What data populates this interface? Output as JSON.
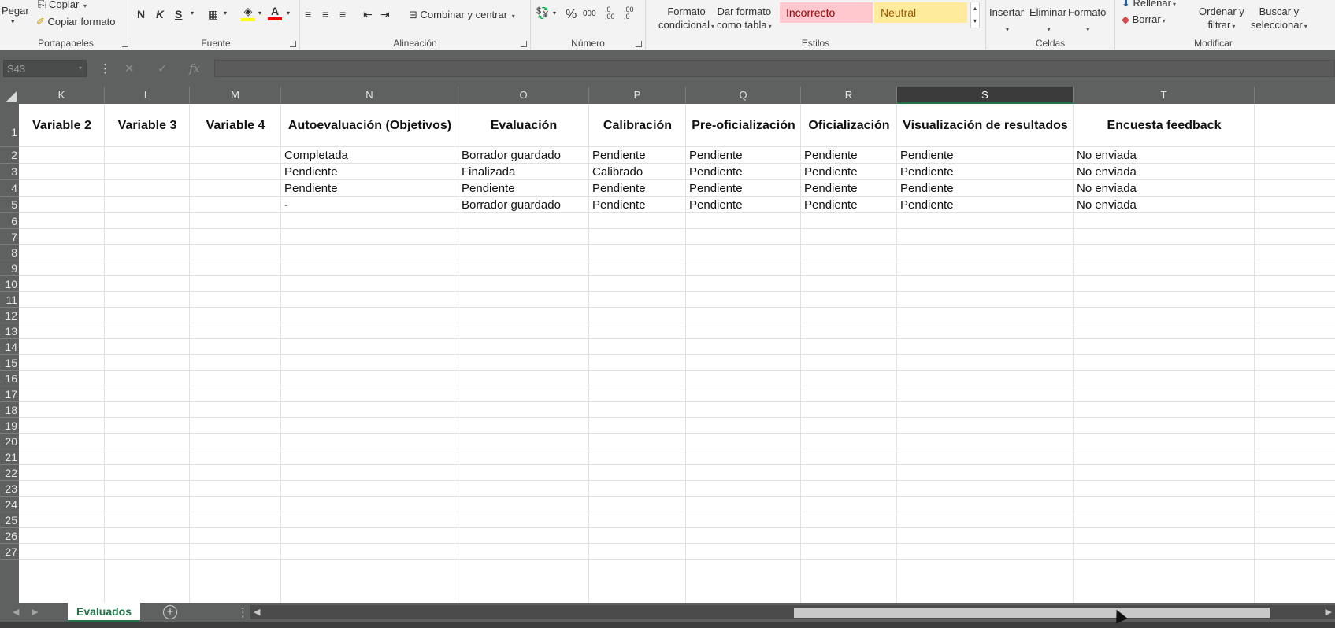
{
  "ribbon": {
    "portapapeles": {
      "paste_label": "Pegar",
      "copy_label": "Copiar",
      "copy_format_label": "Copiar formato",
      "group_label": "Portapapeles"
    },
    "fuente": {
      "bold": "N",
      "italic": "K",
      "strike": "S",
      "group_label": "Fuente"
    },
    "alineacion": {
      "merge_label": "Combinar y centrar",
      "group_label": "Alineación"
    },
    "numero": {
      "percent": "%",
      "thousands": "000",
      "inc_dec": ",0 ,00",
      "dec_dec": ",00 ,0",
      "group_label": "Número"
    },
    "estilos": {
      "cond_format_l1": "Formato",
      "cond_format_l2": "condicional",
      "table_format_l1": "Dar formato",
      "table_format_l2": "como tabla",
      "style_bad": "Incorrecto",
      "style_neutral": "Neutral",
      "group_label": "Estilos"
    },
    "celdas": {
      "insert": "Insertar",
      "delete": "Eliminar",
      "format": "Formato",
      "group_label": "Celdas"
    },
    "modificar": {
      "fill": "Rellenar",
      "clear": "Borrar",
      "sort_l1": "Ordenar y",
      "sort_l2": "filtrar",
      "find_l1": "Buscar y",
      "find_l2": "seleccionar",
      "group_label": "Modificar"
    }
  },
  "formula_bar": {
    "name_box": "S43",
    "fx": "fx",
    "value": ""
  },
  "columns": [
    "K",
    "L",
    "M",
    "N",
    "O",
    "P",
    "Q",
    "R",
    "S",
    "T"
  ],
  "selected_column": "S",
  "rows": [
    "1",
    "2",
    "3",
    "4",
    "5",
    "6",
    "7",
    "8",
    "9",
    "10",
    "11",
    "12",
    "13",
    "14",
    "15",
    "16",
    "17",
    "18",
    "19",
    "20",
    "21",
    "22",
    "23",
    "24",
    "25",
    "26",
    "27"
  ],
  "headers": [
    "Variable 2",
    "Variable 3",
    "Variable 4",
    "Autoevaluación (Objetivos)",
    "Evaluación",
    "Calibración",
    "Pre-oficialización",
    "Oficialización",
    "Visualización de resultados",
    "Encuesta feedback"
  ],
  "data_rows": [
    [
      "",
      "",
      "",
      "Completada",
      "Borrador guardado",
      "Pendiente",
      "Pendiente",
      "Pendiente",
      "Pendiente",
      "No enviada"
    ],
    [
      "",
      "",
      "",
      "Pendiente",
      "Finalizada",
      "Calibrado",
      "Pendiente",
      "Pendiente",
      "Pendiente",
      "No enviada"
    ],
    [
      "",
      "",
      "",
      "Pendiente",
      "Pendiente",
      "Pendiente",
      "Pendiente",
      "Pendiente",
      "Pendiente",
      "No enviada"
    ],
    [
      "",
      "",
      "",
      "-",
      "Borrador guardado",
      "Pendiente",
      "Pendiente",
      "Pendiente",
      "Pendiente",
      "No enviada"
    ]
  ],
  "sheet_tab": "Evaluados",
  "colors": {
    "accent": "#217346",
    "bad_bg": "#ffc7ce",
    "bad_fg": "#9c0006",
    "neutral_bg": "#ffeb9c",
    "neutral_fg": "#9c5700"
  }
}
